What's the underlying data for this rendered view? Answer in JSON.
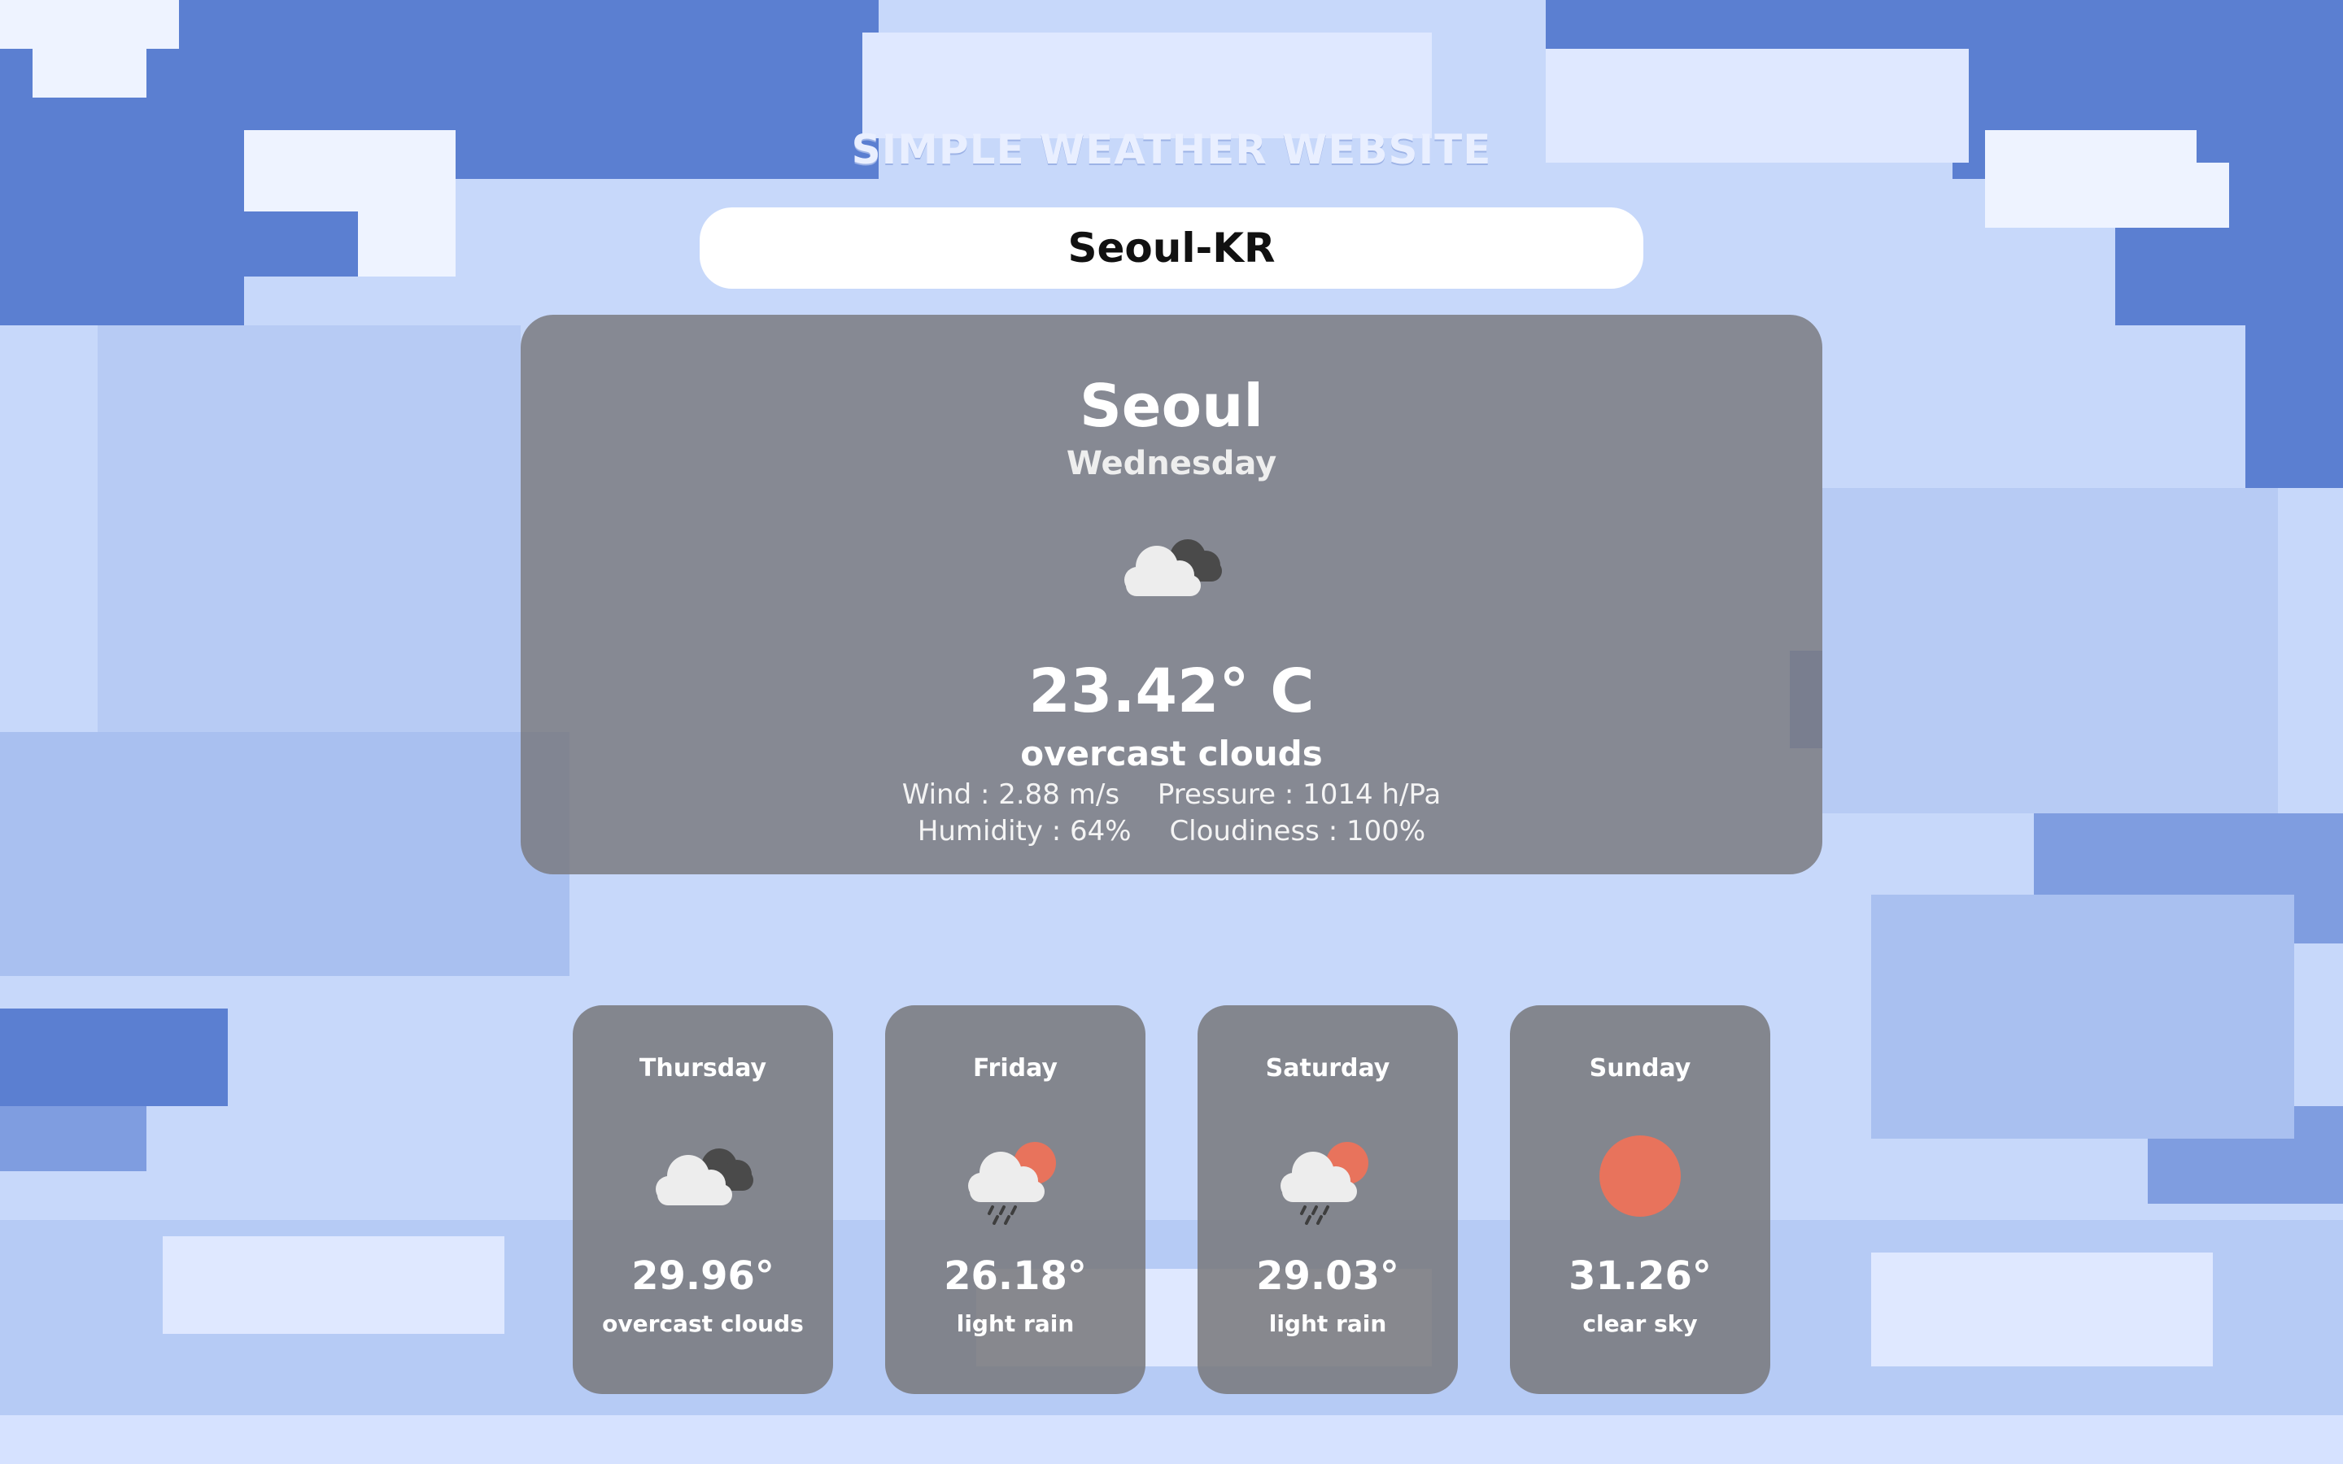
{
  "header": {
    "title": "SIMPLE WEATHER WEBSITE"
  },
  "search": {
    "value": "Seoul-KR"
  },
  "current": {
    "city": "Seoul",
    "day": "Wednesday",
    "icon": "overcast-clouds-icon",
    "temperature": "23.42° C",
    "description": "overcast clouds",
    "wind": "Wind : 2.88 m/s",
    "pressure": "Pressure : 1014 h/Pa",
    "humidity": "Humidity : 64%",
    "cloudiness": "Cloudiness : 100%"
  },
  "forecast": [
    {
      "day": "Thursday",
      "icon": "overcast-clouds-icon",
      "temp": "29.96°",
      "desc": "overcast clouds"
    },
    {
      "day": "Friday",
      "icon": "light-rain-icon",
      "temp": "26.18°",
      "desc": "light rain"
    },
    {
      "day": "Saturday",
      "icon": "light-rain-icon",
      "temp": "29.03°",
      "desc": "light rain"
    },
    {
      "day": "Sunday",
      "icon": "clear-sky-icon",
      "temp": "31.26°",
      "desc": "clear sky"
    }
  ],
  "colors": {
    "sky": "#5b7fd1",
    "cloud_light": "#c7d8fa",
    "card": "#78787c",
    "sun": "#e8735c"
  }
}
